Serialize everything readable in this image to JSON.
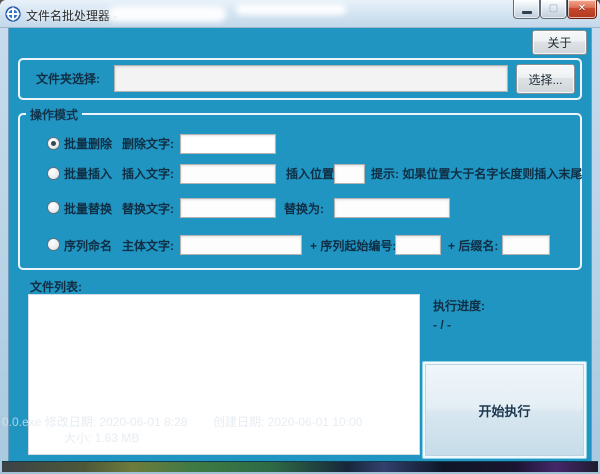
{
  "window": {
    "title": "文件名批处理器 -"
  },
  "icons": {
    "app_icon": "blue-circle-with-white-cross",
    "minimize_glyph": "",
    "maximize_glyph": "▢",
    "close_glyph": "✕"
  },
  "about_button": "关于",
  "folder_section": {
    "label": "文件夹选择:",
    "input_value": "",
    "browse_button": "选择..."
  },
  "mode_section": {
    "title": "操作模式",
    "rows": [
      {
        "radio_label": "批量删除",
        "selected": true,
        "field1_label": "删除文字:",
        "field1_value": ""
      },
      {
        "radio_label": "批量插入",
        "selected": false,
        "field1_label": "插入文字:",
        "field1_value": "",
        "field2_label": "插入位置:",
        "field2_value": "",
        "hint": "提示: 如果位置大于名字长度则插入末尾"
      },
      {
        "radio_label": "批量替换",
        "selected": false,
        "field1_label": "替换文字:",
        "field1_value": "",
        "field2_label": "替换为:",
        "field2_value": ""
      },
      {
        "radio_label": "序列命名",
        "selected": false,
        "field1_label": "主体文字:",
        "field1_value": "",
        "field2_label": "+ 序列起始编号:",
        "field2_value": "",
        "field3_label": "+ 后缀名:",
        "field3_value": ""
      }
    ]
  },
  "file_list_section": {
    "label": "文件列表:",
    "items": []
  },
  "progress_section": {
    "label": "执行进度:",
    "value": "- / -"
  },
  "run_button": "开始执行",
  "background_ghost_text": {
    "modified_line": "0.0.exe  修改日期: 2020-06-01 8:28",
    "created_line": "创建日期: 2020-06-01 10:00",
    "size_line": "大小: 1.63 MB"
  },
  "colors": {
    "client_background": "#2095c2",
    "titlebar": "#d4e4f2",
    "group_border": "#edf5fa",
    "button_face": "#e9f1f7",
    "close_button": "#c94a2e",
    "label_text": "#102e44",
    "run_button_face": "#dce9f2"
  }
}
